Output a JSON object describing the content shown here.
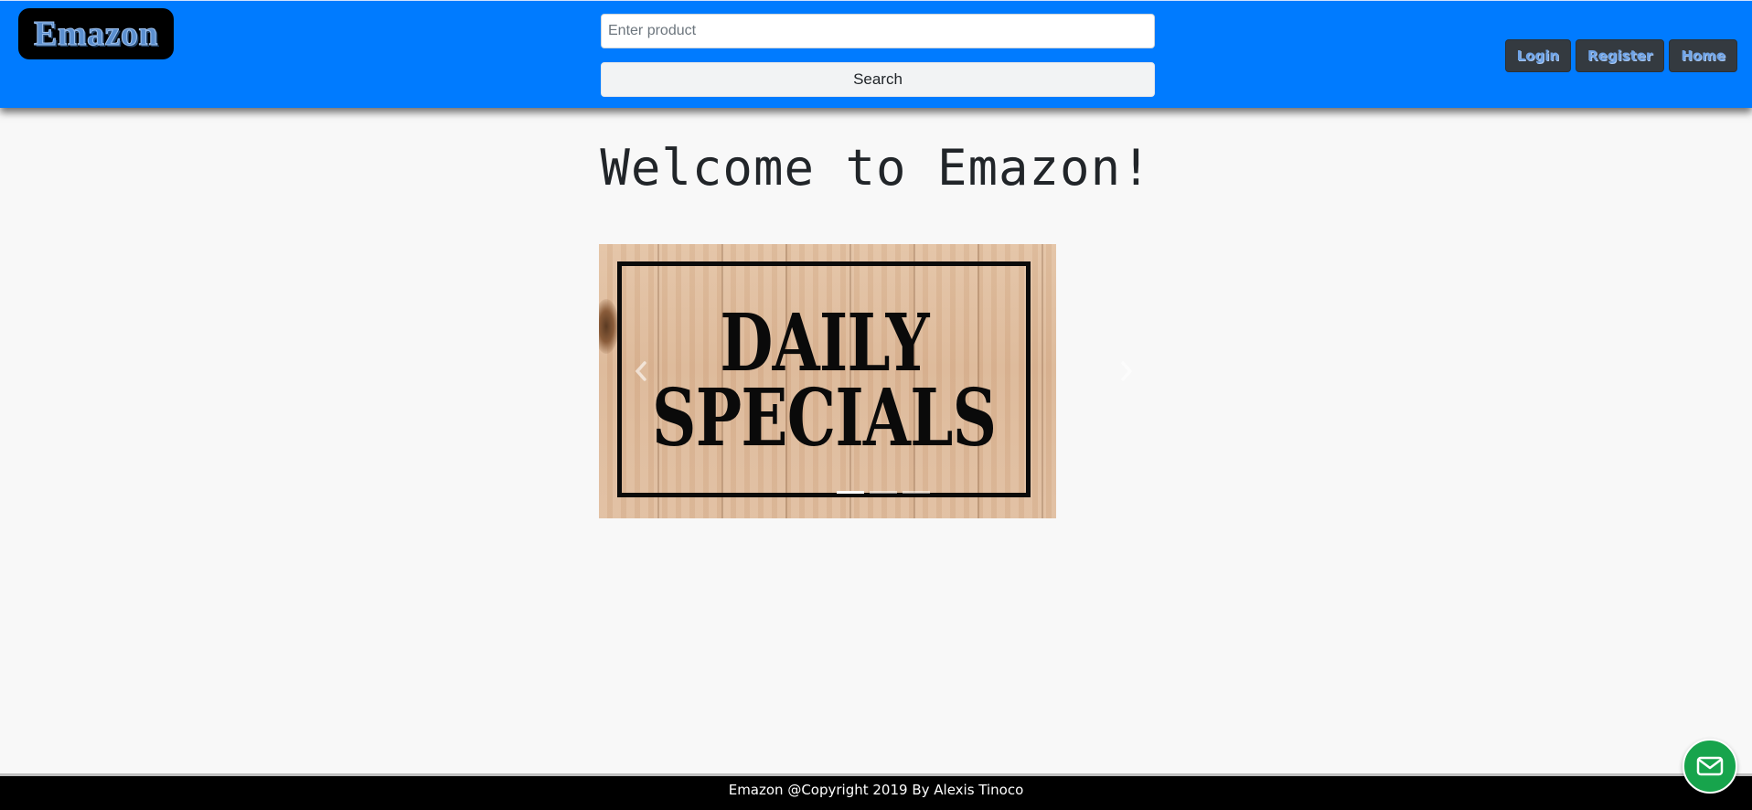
{
  "header": {
    "logo_text": "Emazon",
    "search": {
      "placeholder": "Enter product",
      "value": "",
      "button_label": "Search"
    },
    "nav": [
      {
        "label": "Login"
      },
      {
        "label": "Register"
      },
      {
        "label": "Home"
      }
    ],
    "colors": {
      "bar": "#007bff",
      "nav_button": "#343a40",
      "nav_text": "#6fa3e6"
    }
  },
  "main": {
    "title": "Welcome to Emazon!",
    "carousel": {
      "slides": [
        {
          "line1": "DAILY",
          "line2": "SPECIALS",
          "active": true
        },
        {
          "active": false
        },
        {
          "active": false
        }
      ],
      "prev_icon": "chevron-left-icon",
      "next_icon": "chevron-right-icon",
      "active_index": 0
    }
  },
  "footer": {
    "text": "Emazon @Copyright 2019 By Alexis Tinoco"
  },
  "floating": {
    "mail_icon": "mail-icon",
    "color": "#17a44c"
  }
}
